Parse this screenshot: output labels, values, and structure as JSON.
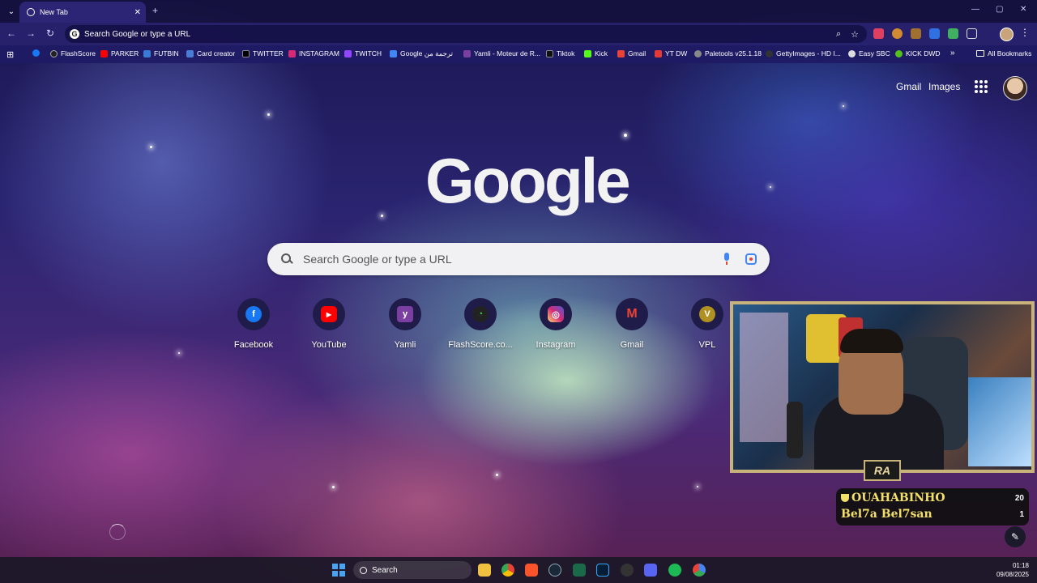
{
  "browser": {
    "tab_title": "New Tab",
    "omnibox_placeholder": "Search Google or type a URL"
  },
  "bookmarks": [
    {
      "label": "",
      "color": "#1877f2"
    },
    {
      "label": "FlashScore",
      "color": "#222222"
    },
    {
      "label": "PARKER",
      "color": "#ff0000"
    },
    {
      "label": "FUTBIN",
      "color": "#3a7bd5"
    },
    {
      "label": "Card creator",
      "color": "#4a7bd5"
    },
    {
      "label": "TWITTER",
      "color": "#000000"
    },
    {
      "label": "INSTAGRAM",
      "color": "#d62976"
    },
    {
      "label": "TWITCH",
      "color": "#9146ff"
    },
    {
      "label": "Google ترجمة من",
      "color": "#4285f4"
    },
    {
      "label": "Yamli - Moteur de R...",
      "color": "#7a3fa0"
    },
    {
      "label": "Tiktok",
      "color": "#111111"
    },
    {
      "label": "Kick",
      "color": "#53fc18"
    },
    {
      "label": "Gmail",
      "color": "#ea4335"
    },
    {
      "label": "YT DW",
      "color": "#e53935"
    },
    {
      "label": "Paletools v25.1.18",
      "color": "#888888"
    },
    {
      "label": "GettyImages - HD I...",
      "color": "#333333"
    },
    {
      "label": "Easy SBC",
      "color": "#dddddd"
    },
    {
      "label": "KICK DWD",
      "color": "#53c11a"
    }
  ],
  "bookmarks_all_label": "All Bookmarks",
  "google": {
    "gmail_label": "Gmail",
    "images_label": "Images",
    "logo_text": "Google",
    "search_placeholder": "Search Google or type a URL"
  },
  "shortcuts": [
    {
      "label": "Facebook",
      "glyph": "f",
      "color": "#1877f2"
    },
    {
      "label": "YouTube",
      "glyph": "▶",
      "color": "#ff0000"
    },
    {
      "label": "Yamli",
      "glyph": "y",
      "color": "#7a3fa0"
    },
    {
      "label": "FlashScore.co...",
      "glyph": "◔",
      "color": "#222222"
    },
    {
      "label": "Instagram",
      "glyph": "◎",
      "color": "#d62976"
    },
    {
      "label": "Gmail",
      "glyph": "M",
      "color": "#ea4335"
    },
    {
      "label": "VPL",
      "glyph": "V",
      "color": "#b09020"
    }
  ],
  "overlay": {
    "logo": "RA",
    "leaderboard": [
      {
        "name": "OUAHABINHO",
        "score": "20"
      },
      {
        "name": "Bel7a Bel7san",
        "score": "1"
      }
    ]
  },
  "taskbar": {
    "search_label": "Search",
    "time": "01:18",
    "date": "09/08/2025"
  }
}
